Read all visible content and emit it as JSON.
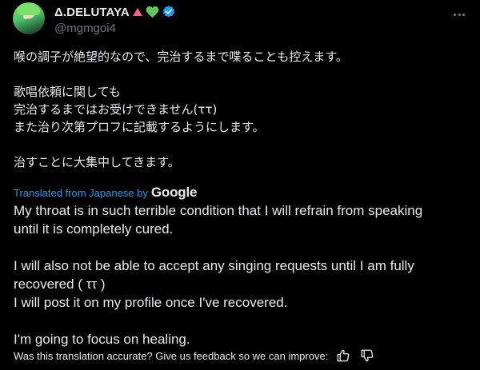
{
  "author": {
    "display_name": "Δ.DELUTAYA",
    "handle": "@mgmgoi4",
    "badges": [
      "red-triangle-icon",
      "green-heart-icon",
      "verified-badge-icon"
    ]
  },
  "tweet": {
    "jp_lines": [
      "喉の調子が絶望的なので、完治するまで喋ることも控えます。",
      "",
      "歌唱依頼に関しても",
      "完治するまではお受けできません(ττ)",
      "また治り次第プロフに記載するようにします。",
      "",
      "治すことに大集中してきます。"
    ],
    "translated_label": "Translated from Japanese by",
    "translator": "Google",
    "en_lines": [
      "My throat is in such terrible condition that I will refrain from speaking",
      "until it is completely cured.",
      "",
      "I will also not be able to accept any singing requests until I am fully",
      "recovered ( ττ )",
      "I will post it on my profile once I've recovered.",
      "",
      "I'm going to focus on healing."
    ]
  },
  "feedback": {
    "prompt": "Was this translation accurate? Give us feedback so we can improve:",
    "thumbs_up_icon": "thumbs-up-icon",
    "thumbs_down_icon": "thumbs-down-icon"
  },
  "colors": {
    "background": "#000000",
    "text": "#e7e9ea",
    "secondary": "#71767b",
    "link": "#1d9bf0",
    "verified": "#1d9bf0",
    "triangle": "#f4617b",
    "heart": "#5cc85c"
  }
}
